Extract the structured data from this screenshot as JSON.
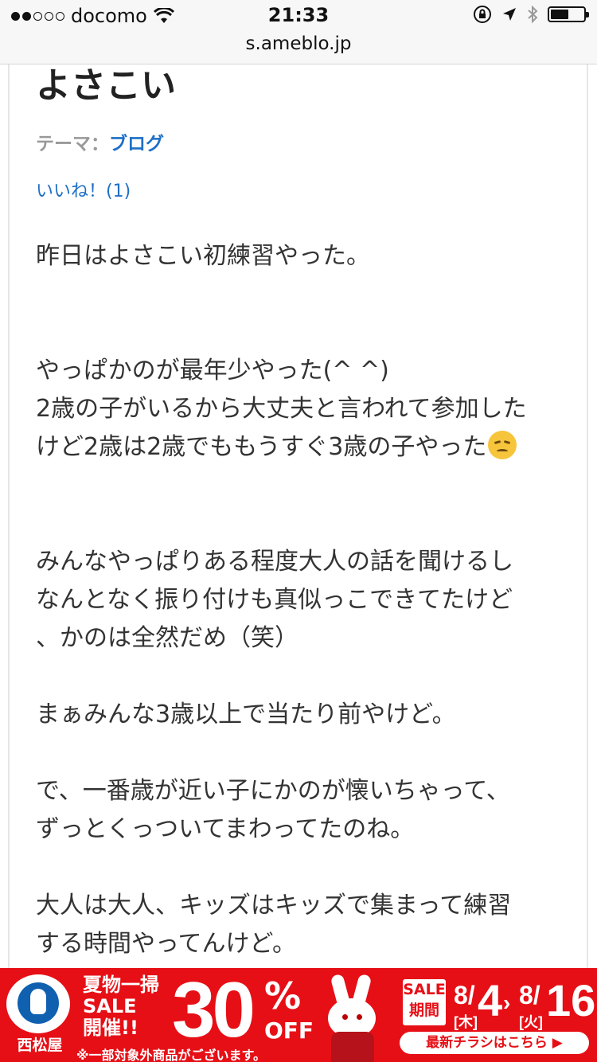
{
  "status": {
    "carrier": "docomo",
    "time": "21:33"
  },
  "browser": {
    "url": "s.ameblo.jp"
  },
  "article": {
    "title": "よさこい",
    "theme_label": "テーマ：",
    "theme_value": "ブログ",
    "like": "いいね！(1)",
    "paragraphs": {
      "p1": "昨日はよさこい初練習やった。",
      "p2a": "やっぱかのが最年少やった(^ ^)",
      "p2b": "2歳の子がいるから大丈夫と言われて参加した",
      "p2c": "けど2歳は2歳でももうすぐ3歳の子やった",
      "p3a": "みんなやっぱりある程度大人の話を聞けるし",
      "p3b": "なんとなく振り付けも真似っこできてたけど",
      "p3c": "、かのは全然だめ（笑）",
      "p4": "まぁみんな3歳以上で当たり前やけど。",
      "p5a": "で、一番歳が近い子にかのが懐いちゃって、",
      "p5b": "ずっとくっついてまわってたのね。",
      "p6a": "大人は大人、キッズはキッズで集まって練習",
      "p6b": "する時間やってんけど。"
    }
  },
  "ad": {
    "brand": "西松屋",
    "line1": "夏物一掃",
    "line2": "SALE",
    "line3": "開催!!",
    "percent": "30",
    "percent_sign": "%",
    "off": "OFF",
    "sale_line1": "SALE",
    "sale_line2": "期間",
    "start_month": "8/",
    "start_day": "4",
    "start_weekday": "[木]",
    "end_month": "8/",
    "end_day": "16",
    "end_weekday": "[火]",
    "cta": "最新チラシはこちら ▶",
    "note": "※一部対象外商品がございます。"
  }
}
